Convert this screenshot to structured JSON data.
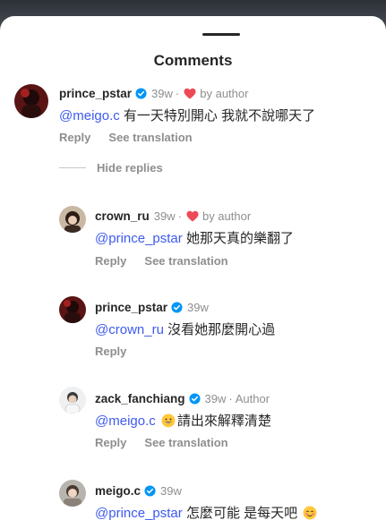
{
  "sheet": {
    "title": "Comments"
  },
  "comments": [
    {
      "username": "prince_pstar",
      "time": "39w",
      "liked_label": "by author",
      "mention": "@meigo.c",
      "text": " 有一天特別開心 我就不說哪天了",
      "reply_label": "Reply",
      "translate_label": "See translation"
    },
    {
      "username": "crown_ru",
      "time": "39w",
      "liked_label": "by author",
      "mention": "@prince_pstar",
      "text": " 她那天真的樂翻了",
      "reply_label": "Reply",
      "translate_label": "See translation"
    },
    {
      "username": "prince_pstar",
      "time": "39w",
      "mention": "@crown_ru",
      "text": " 沒看她那麼開心過",
      "reply_label": "Reply"
    },
    {
      "username": "zack_fanchiang",
      "time": "39w",
      "author_label": "Author",
      "mention": "@meigo.c",
      "text": "請出來解釋清楚",
      "reply_label": "Reply",
      "translate_label": "See translation"
    },
    {
      "username": "meigo.c",
      "time": "39w",
      "mention": "@prince_pstar",
      "text": " 怎麼可能 是每天吧"
    }
  ],
  "hide_replies_label": "Hide replies",
  "colors": {
    "mention": "#3d5af1",
    "verified": "#0095f6",
    "heart": "#ed4956",
    "muted": "#8e8e8e"
  },
  "icons": [
    "verified-badge-icon",
    "heart-icon",
    "grin-emoji-icon",
    "blush-emoji-icon"
  ]
}
